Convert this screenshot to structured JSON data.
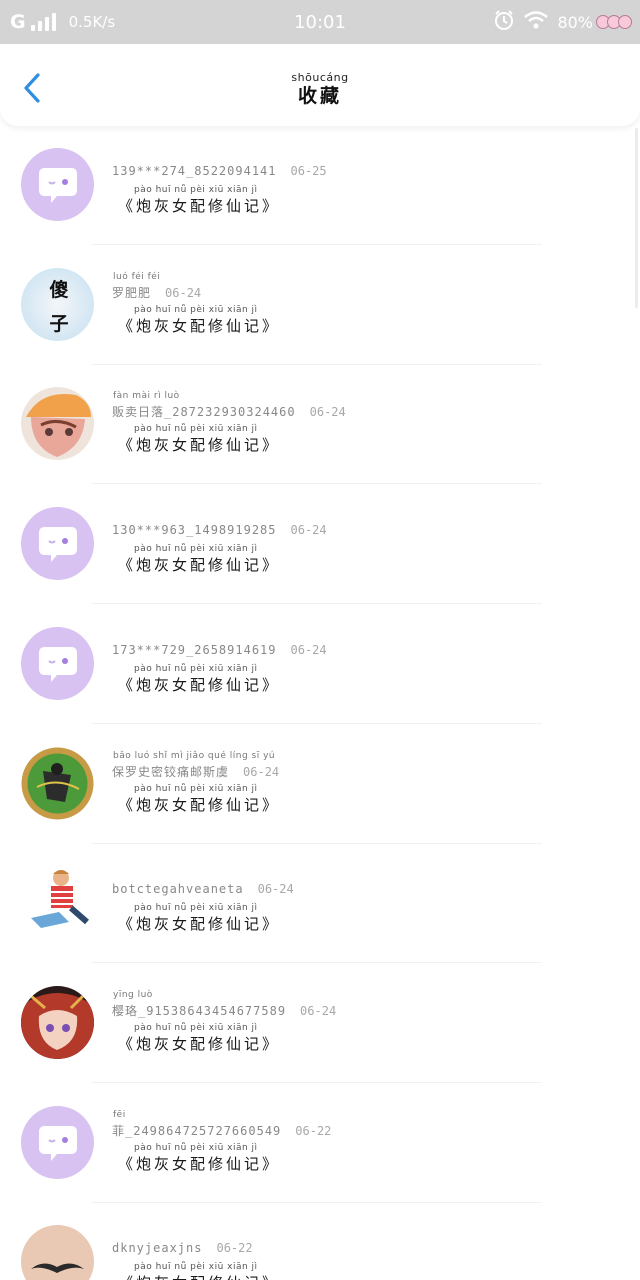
{
  "status_bar": {
    "carrier": "G",
    "speed": "0.5K/s",
    "time": "10:01",
    "battery": "80%"
  },
  "header": {
    "title_pinyin": "shōucáng",
    "title": "收藏",
    "back_icon": "chevron-left-icon",
    "accent": "#2f8ee0"
  },
  "book_title_pinyin": "pào  huī   nǚ   pèi  xiū  xiān   jì",
  "items": [
    {
      "name": "139***274_8522094141",
      "name_pinyin": "",
      "date": "06-25",
      "book": "《炮灰女配修仙记》",
      "avatar": "default-chat-avatar"
    },
    {
      "name": "罗肥肥",
      "name_pinyin": "luó  féi  féi",
      "date": "06-24",
      "book": "《炮灰女配修仙记》",
      "avatar": "text-avatar",
      "avatar_text": "傻子"
    },
    {
      "name": "贩卖日落_287232930324460",
      "name_pinyin": "fàn  mài   rì   luò",
      "date": "06-24",
      "book": "《炮灰女配修仙记》",
      "avatar": "anime-girl-avatar"
    },
    {
      "name": "130***963_1498919285",
      "name_pinyin": "",
      "date": "06-24",
      "book": "《炮灰女配修仙记》",
      "avatar": "default-chat-avatar"
    },
    {
      "name": "173***729_2658914619",
      "name_pinyin": "",
      "date": "06-24",
      "book": "《炮灰女配修仙记》",
      "avatar": "default-chat-avatar"
    },
    {
      "name": "保罗史密铰痛邮斯虞",
      "name_pinyin": "bǎo  luó  shǐ   mì  jiǎo  qué  líng   sī   yú",
      "date": "06-24",
      "book": "《炮灰女配修仙记》",
      "avatar": "badge-avatar"
    },
    {
      "name": "botctegahveaneta",
      "name_pinyin": "",
      "date": "06-24",
      "book": "《炮灰女配修仙记》",
      "avatar": "reading-boy-avatar"
    },
    {
      "name": "樱珞_91538643454677589",
      "name_pinyin": "yīng  luò",
      "date": "06-24",
      "book": "《炮灰女配修仙记》",
      "avatar": "anime-red-avatar"
    },
    {
      "name": "菲_249864725727660549",
      "name_pinyin": "fēi",
      "date": "06-22",
      "book": "《炮灰女配修仙记》",
      "avatar": "default-chat-avatar"
    },
    {
      "name": "dknyjeaxjns",
      "name_pinyin": "",
      "date": "06-22",
      "book": "《炮灰女配修仙记》",
      "avatar": "mustache-avatar"
    }
  ],
  "colors": {
    "default_avatar_bg": "#d8c2f2",
    "status_bar_bg": "#d4d4d4"
  }
}
